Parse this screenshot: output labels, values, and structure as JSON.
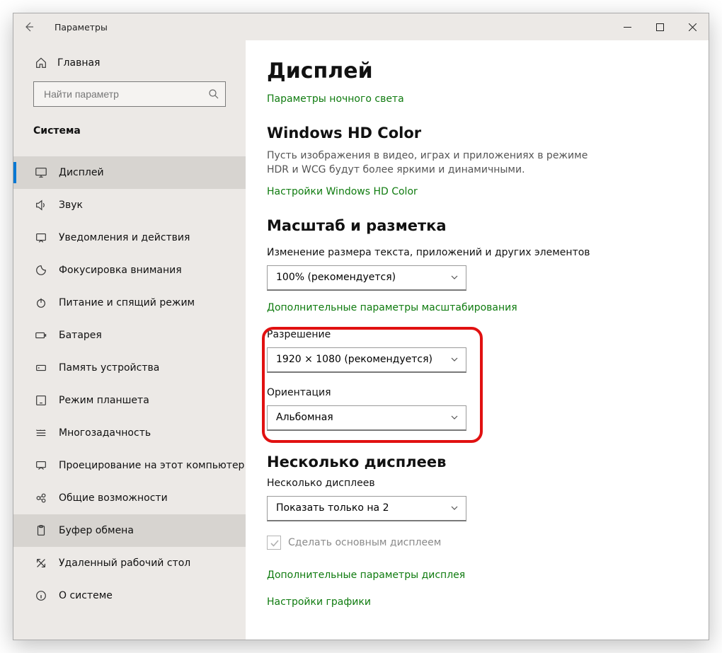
{
  "window": {
    "title": "Параметры"
  },
  "sidebar": {
    "home": "Главная",
    "search_placeholder": "Найти параметр",
    "section": "Система",
    "items": [
      {
        "label": "Дисплей"
      },
      {
        "label": "Звук"
      },
      {
        "label": "Уведомления и действия"
      },
      {
        "label": "Фокусировка внимания"
      },
      {
        "label": "Питание и спящий режим"
      },
      {
        "label": "Батарея"
      },
      {
        "label": "Память устройства"
      },
      {
        "label": "Режим планшета"
      },
      {
        "label": "Многозадачность"
      },
      {
        "label": "Проецирование на этот компьютер"
      },
      {
        "label": "Общие возможности"
      },
      {
        "label": "Буфер обмена"
      },
      {
        "label": "Удаленный рабочий стол"
      },
      {
        "label": "О системе"
      }
    ]
  },
  "main": {
    "page_title": "Дисплей",
    "night_light_link": "Параметры ночного света",
    "hd_color": {
      "heading": "Windows HD Color",
      "desc": "Пусть изображения в видео, играх и приложениях в режиме HDR и WCG будут более яркими и динамичными.",
      "link": "Настройки Windows HD Color"
    },
    "scale": {
      "heading": "Масштаб и разметка",
      "size_label": "Изменение размера текста, приложений и других элементов",
      "size_value": "100% (рекомендуется)",
      "advanced_link": "Дополнительные параметры масштабирования",
      "resolution_label": "Разрешение",
      "resolution_value": "1920 × 1080 (рекомендуется)",
      "orientation_label": "Ориентация",
      "orientation_value": "Альбомная"
    },
    "multi": {
      "heading": "Несколько дисплеев",
      "label": "Несколько дисплеев",
      "value": "Показать только на 2",
      "make_main": "Сделать основным дисплеем",
      "advanced_link": "Дополнительные параметры дисплея",
      "graphics_link": "Настройки графики"
    }
  }
}
